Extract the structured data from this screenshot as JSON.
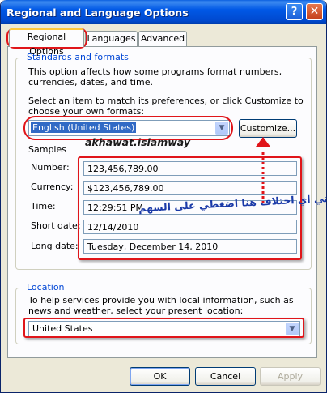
{
  "window": {
    "title": "Regional and Language Options"
  },
  "titlebar_buttons": {
    "help": "?",
    "close": "✕"
  },
  "tabs": [
    {
      "label": "Regional Options",
      "active": true
    },
    {
      "label": "Languages",
      "active": false
    },
    {
      "label": "Advanced",
      "active": false
    }
  ],
  "standards": {
    "group_title": "Standards and formats",
    "description": "This option affects how some programs format numbers, currencies, dates, and time.",
    "instruction": "Select an item to match its preferences, or click Customize to choose your own formats:",
    "selected_locale": "English (United States)",
    "customize_label": "Customize..."
  },
  "samples": {
    "title": "Samples",
    "rows": [
      {
        "label": "Number:",
        "value": "123,456,789.00"
      },
      {
        "label": "Currency:",
        "value": "$123,456,789.00"
      },
      {
        "label": "Time:",
        "value": "12:29:51 PM"
      },
      {
        "label": "Short date:",
        "value": "12/14/2010"
      },
      {
        "label": "Long date:",
        "value": "Tuesday, December 14, 2010"
      }
    ]
  },
  "location": {
    "group_title": "Location",
    "description": "To help services provide you with local information, such as news and weather, select your present location:",
    "selected": "United States"
  },
  "footer": {
    "ok": "OK",
    "cancel": "Cancel",
    "apply": "Apply"
  },
  "annotations": {
    "watermark": "akhawat.islamway",
    "arabic_note": "إذا وجدتي اي اختلاف هنا اضغطي على السهم",
    "highlight_color": "#e0151a"
  },
  "icons": {
    "dropdown": "chevron-down-icon",
    "help": "help-icon",
    "close": "close-icon"
  }
}
